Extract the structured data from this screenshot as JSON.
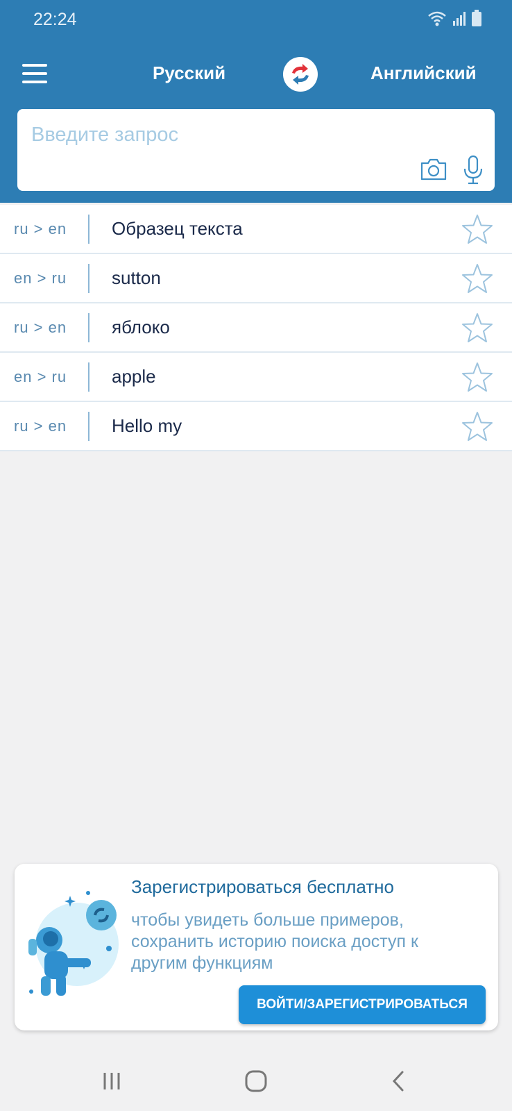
{
  "status_bar": {
    "time": "22:24"
  },
  "header": {
    "source_language": "Русский",
    "target_language": "Английский",
    "accent_color": "#2d7db4",
    "icons": {
      "menu": "hamburger-menu-icon",
      "swap": "swap-languages-icon"
    }
  },
  "search": {
    "placeholder": "Введите запрос",
    "value": "",
    "icons": {
      "camera": "camera-icon",
      "mic": "microphone-icon"
    }
  },
  "history": {
    "items": [
      {
        "direction": "ru > en",
        "text": "Образец текста"
      },
      {
        "direction": "en > ru",
        "text": "sutton"
      },
      {
        "direction": "ru > en",
        "text": "яблоко"
      },
      {
        "direction": "en > ru",
        "text": "apple"
      },
      {
        "direction": "ru > en",
        "text": "Hello my"
      }
    ]
  },
  "promo": {
    "title": "Зарегистрироваться бесплатно",
    "text": "чтобы увидеть больше примеров, сохранить историю поиска доступ к другим функциям",
    "button_label": "ВОЙТИ/ЗАРЕГИСТРИРОВАТЬСЯ",
    "button_color": "#1e8fd8"
  },
  "nav_bar": {
    "icons": [
      "recent-apps-icon",
      "home-icon",
      "back-icon"
    ]
  }
}
